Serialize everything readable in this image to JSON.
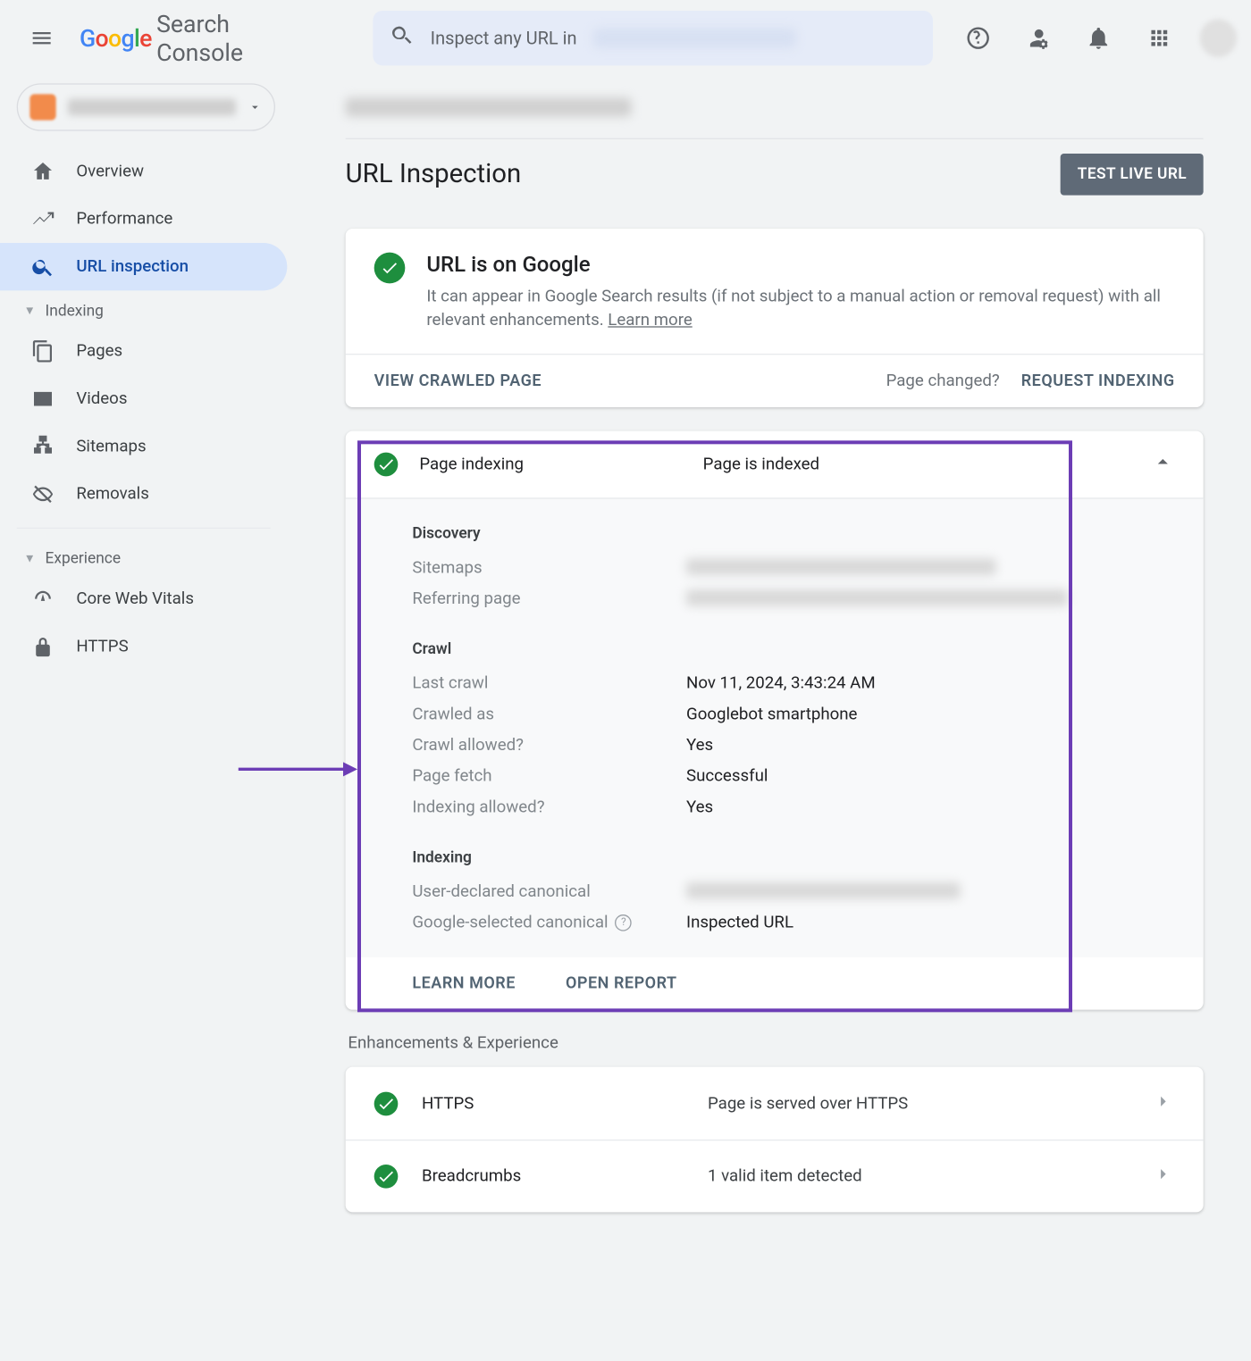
{
  "header": {
    "product": "Search Console",
    "search_placeholder": "Inspect any URL in"
  },
  "sidebar": {
    "items": [
      {
        "label": "Overview",
        "icon": "home-icon"
      },
      {
        "label": "Performance",
        "icon": "trend-icon"
      },
      {
        "label": "URL inspection",
        "icon": "search-icon"
      }
    ],
    "sections": [
      {
        "title": "Indexing",
        "items": [
          {
            "label": "Pages",
            "icon": "pages-icon"
          },
          {
            "label": "Videos",
            "icon": "video-icon"
          },
          {
            "label": "Sitemaps",
            "icon": "sitemap-icon"
          },
          {
            "label": "Removals",
            "icon": "removals-icon"
          }
        ]
      },
      {
        "title": "Experience",
        "items": [
          {
            "label": "Core Web Vitals",
            "icon": "speed-icon"
          },
          {
            "label": "HTTPS",
            "icon": "lock-icon"
          }
        ]
      }
    ]
  },
  "page": {
    "title": "URL Inspection",
    "test_live_btn": "TEST LIVE URL"
  },
  "status": {
    "title": "URL is on Google",
    "desc1": "It can appear in Google Search results (if not subject to a manual action or removal request) with all relevant enhancements. ",
    "learn_more": "Learn more",
    "view_crawled": "VIEW CRAWLED PAGE",
    "page_changed": "Page changed?",
    "request_indexing": "REQUEST INDEXING"
  },
  "indexing": {
    "header_label": "Page indexing",
    "header_value": "Page is indexed",
    "discovery": {
      "title": "Discovery",
      "sitemaps_k": "Sitemaps",
      "referring_k": "Referring page"
    },
    "crawl": {
      "title": "Crawl",
      "last_crawl_k": "Last crawl",
      "last_crawl_v": "Nov 11, 2024, 3:43:24 AM",
      "crawled_as_k": "Crawled as",
      "crawled_as_v": "Googlebot smartphone",
      "crawl_allowed_k": "Crawl allowed?",
      "crawl_allowed_v": "Yes",
      "page_fetch_k": "Page fetch",
      "page_fetch_v": "Successful",
      "indexing_allowed_k": "Indexing allowed?",
      "indexing_allowed_v": "Yes"
    },
    "idx": {
      "title": "Indexing",
      "user_canonical_k": "User-declared canonical",
      "google_canonical_k": "Google-selected canonical",
      "google_canonical_v": "Inspected URL"
    },
    "learn_more": "LEARN MORE",
    "open_report": "OPEN REPORT"
  },
  "enhancements": {
    "title": "Enhancements & Experience",
    "rows": [
      {
        "label": "HTTPS",
        "value": "Page is served over HTTPS"
      },
      {
        "label": "Breadcrumbs",
        "value": "1 valid item detected"
      }
    ]
  }
}
